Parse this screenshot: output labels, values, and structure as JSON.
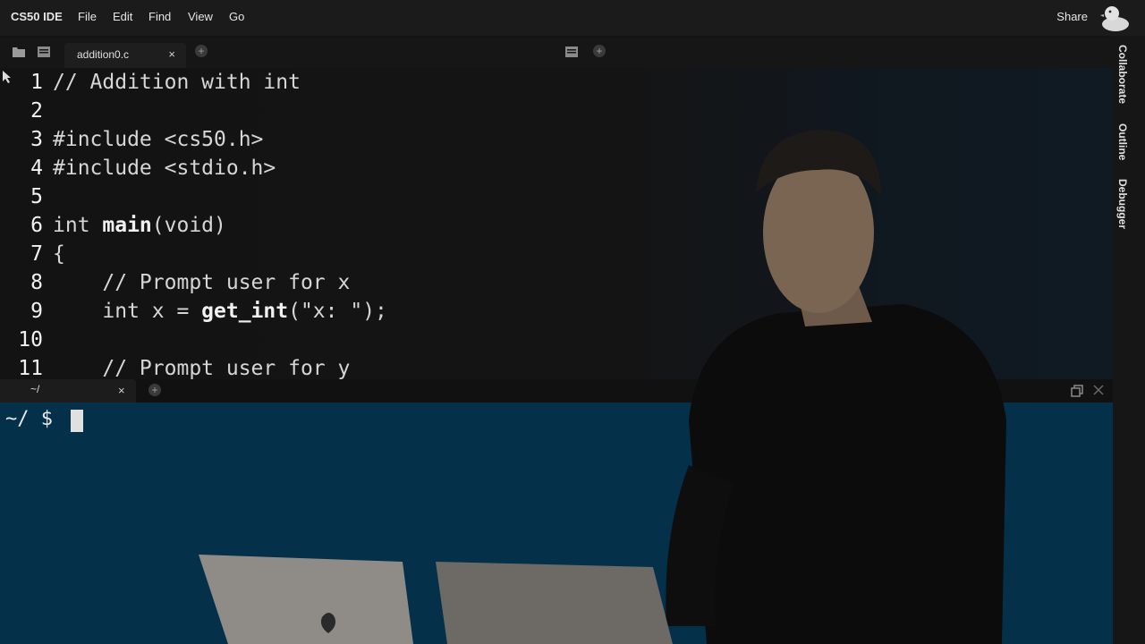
{
  "menubar": {
    "brand": "CS50 IDE",
    "menus": [
      "File",
      "Edit",
      "Find",
      "View",
      "Go"
    ],
    "share": "Share",
    "logo_icon": "duck-icon"
  },
  "editor": {
    "tab_label": "addition0.c",
    "tab_close": "×",
    "new_tab": "+",
    "lines": [
      {
        "num": "1",
        "code": "// Addition with int"
      },
      {
        "num": "2",
        "code": ""
      },
      {
        "num": "3",
        "code": "#include <cs50.h>"
      },
      {
        "num": "4",
        "code": "#include <stdio.h>"
      },
      {
        "num": "5",
        "code": ""
      },
      {
        "num": "6",
        "code": "int ",
        "fn": "main",
        "rest": "(void)"
      },
      {
        "num": "7",
        "code": "{"
      },
      {
        "num": "8",
        "code": "    // Prompt user for x"
      },
      {
        "num": "9",
        "code": "    int x = ",
        "fn": "get_int",
        "rest": "(\"x: \");"
      },
      {
        "num": "10",
        "code": ""
      },
      {
        "num": "11",
        "code": "    // Prompt user for y"
      }
    ]
  },
  "terminal": {
    "tab_label": "~/",
    "tab_close": "×",
    "new_tab": "+",
    "prompt": "~/ $ "
  },
  "sidebar": {
    "items": [
      "Collaborate",
      "Outline",
      "Debugger"
    ]
  },
  "colors": {
    "terminal_bg": "#043049",
    "editor_bg": "#141414",
    "menubar_bg": "#1b1b1b"
  }
}
